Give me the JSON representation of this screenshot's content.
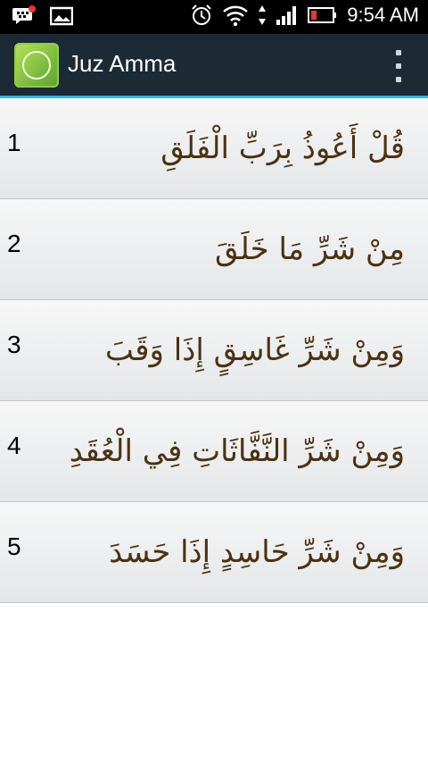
{
  "status_bar": {
    "time": "9:54 AM",
    "icons": [
      "bbm-icon",
      "image-icon",
      "alarm-icon",
      "wifi-icon",
      "data-arrows-icon",
      "signal-icon",
      "battery-icon"
    ],
    "battery_color": "#e53935"
  },
  "action_bar": {
    "title": "Juz Amma",
    "accent": "#33b5e5"
  },
  "verses": [
    {
      "number": "1",
      "text": "قُلْ أَعُوذُ بِرَبِّ الْفَلَقِ"
    },
    {
      "number": "2",
      "text": "مِنْ شَرِّ مَا خَلَقَ"
    },
    {
      "number": "3",
      "text": "وَمِنْ شَرِّ غَاسِقٍ إِذَا وَقَبَ"
    },
    {
      "number": "4",
      "text": "وَمِنْ شَرِّ النَّفَّاثَاتِ فِي الْعُقَدِ"
    },
    {
      "number": "5",
      "text": "وَمِنْ شَرِّ حَاسِدٍ إِذَا حَسَدَ"
    }
  ]
}
